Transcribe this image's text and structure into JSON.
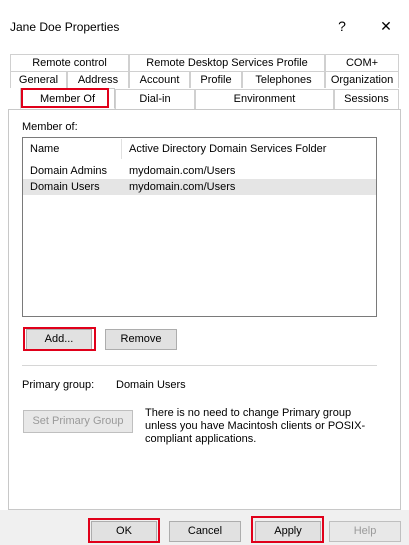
{
  "window": {
    "title": "Jane Doe Properties",
    "help_glyph": "?",
    "close_glyph": "✕"
  },
  "tabs": {
    "row1": [
      "Remote control",
      "Remote Desktop Services Profile",
      "COM+"
    ],
    "row2": [
      "General",
      "Address",
      "Account",
      "Profile",
      "Telephones",
      "Organization"
    ],
    "row3": [
      "Member Of",
      "Dial-in",
      "Environment",
      "Sessions"
    ],
    "active": "Member Of"
  },
  "member_of": {
    "label": "Member of:",
    "columns": [
      "Name",
      "Active Directory Domain Services Folder"
    ],
    "rows": [
      {
        "name": "Domain Admins",
        "folder": "mydomain.com/Users"
      },
      {
        "name": "Domain Users",
        "folder": "mydomain.com/Users"
      }
    ],
    "selected_row": 1
  },
  "buttons": {
    "add": "Add...",
    "remove": "Remove",
    "set_primary": "Set Primary Group"
  },
  "primary_group": {
    "label": "Primary group:",
    "value": "Domain Users",
    "note": "There is no need to change Primary group unless you have Macintosh clients or POSIX-compliant applications."
  },
  "dialog_buttons": {
    "ok": "OK",
    "cancel": "Cancel",
    "apply": "Apply",
    "help": "Help"
  },
  "colors": {
    "highlight": "#e0001a",
    "selection": "#e5e5e5"
  }
}
